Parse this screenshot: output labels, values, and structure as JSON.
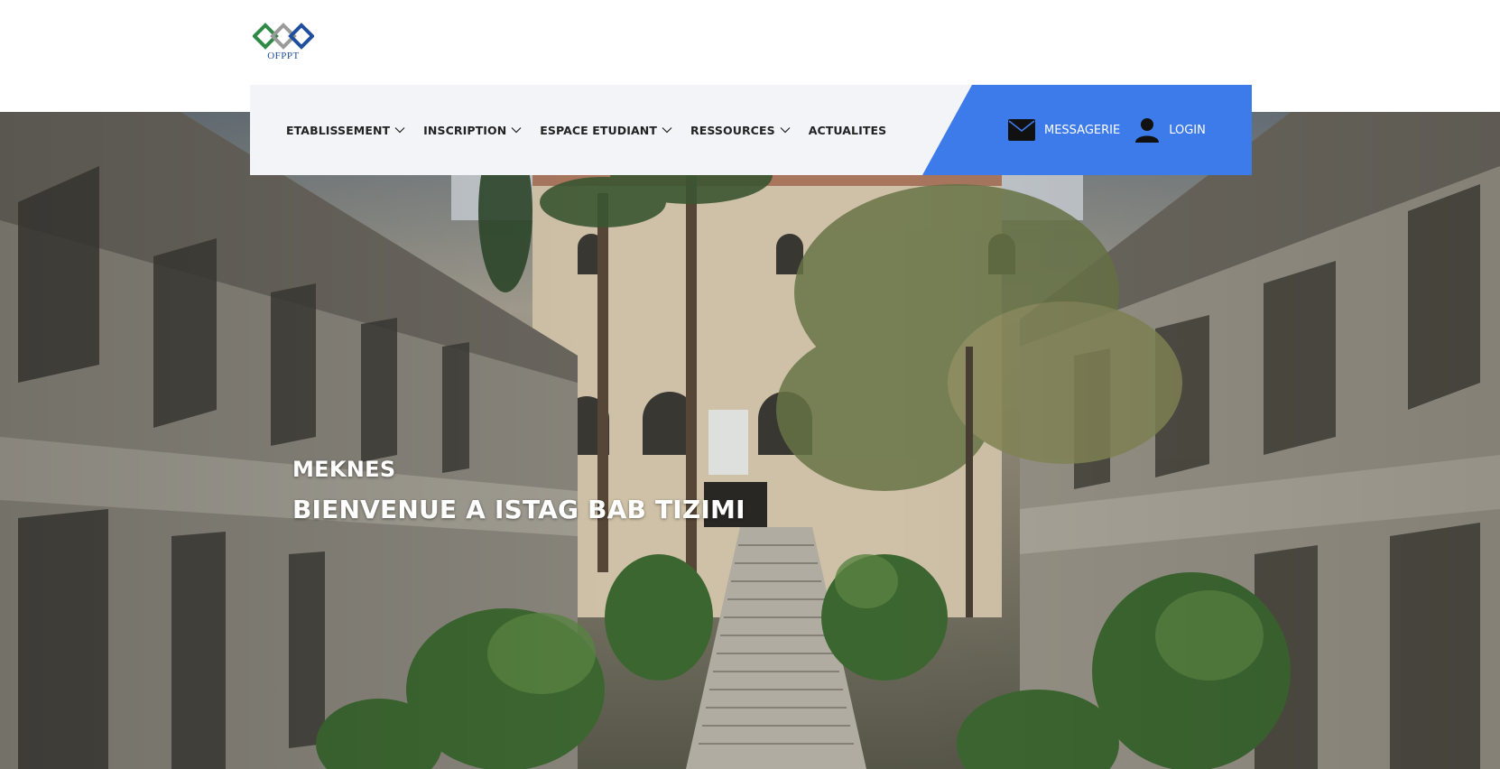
{
  "brand": {
    "logo_text": "OFPPT",
    "colors": {
      "green": "#2e8b47",
      "gray": "#9a9a9a",
      "blue": "#1f4e9c"
    }
  },
  "nav": {
    "items": [
      {
        "label": "ETABLISSEMENT",
        "has_dropdown": true
      },
      {
        "label": "INSCRIPTION",
        "has_dropdown": true
      },
      {
        "label": "ESPACE ETUDIANT",
        "has_dropdown": true
      },
      {
        "label": "RESSOURCES",
        "has_dropdown": true
      },
      {
        "label": "ACTUALITES",
        "has_dropdown": false
      }
    ],
    "actions": {
      "messagerie": {
        "label": "MESSAGERIE",
        "icon": "envelope-icon"
      },
      "login": {
        "label": "LOGIN",
        "icon": "user-icon"
      }
    },
    "colors": {
      "bar_bg": "#f3f4f8",
      "accent_blue": "#3d7bea",
      "text": "#222222"
    }
  },
  "hero": {
    "city": "MEKNES",
    "title": "BIENVENUE A ISTAG BAB TIZIMI"
  }
}
